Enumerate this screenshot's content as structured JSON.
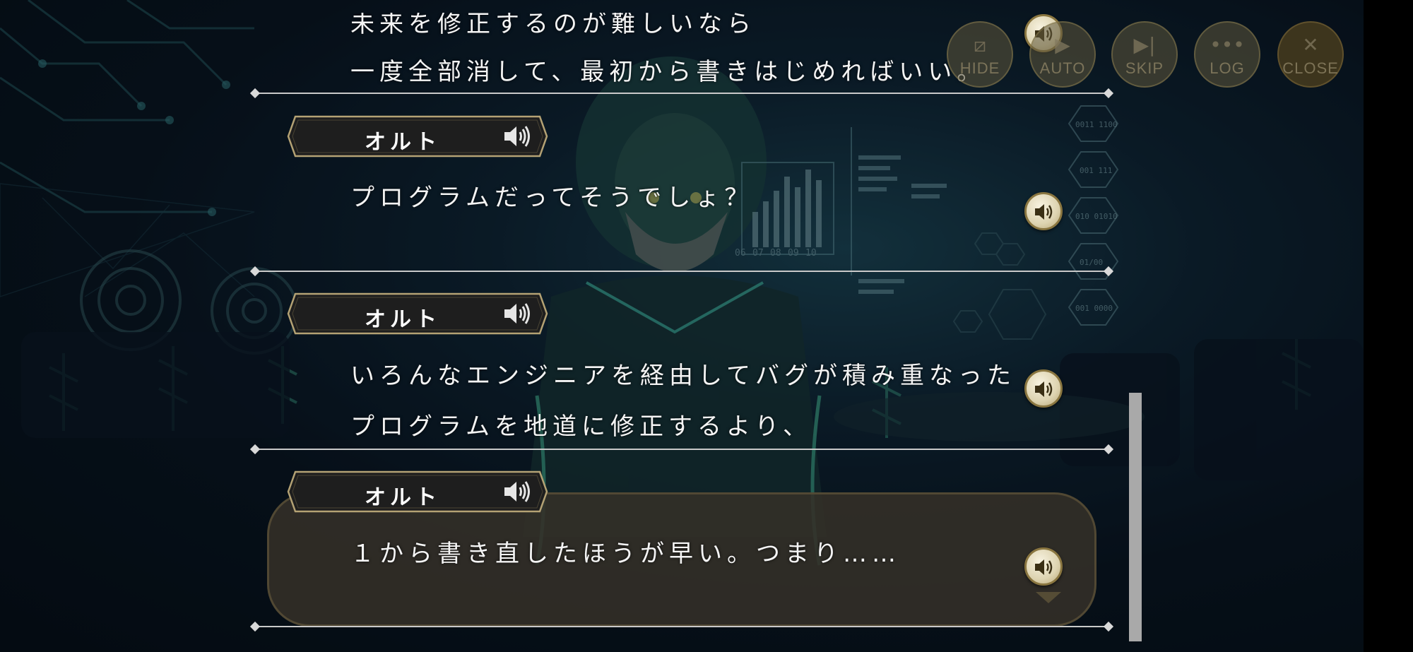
{
  "controls": [
    {
      "label": "HIDE",
      "glyph": "⧄"
    },
    {
      "label": "AUTO",
      "glyph": "▶"
    },
    {
      "label": "SKIP",
      "glyph": "▶|"
    },
    {
      "label": "LOG",
      "glyph": "•••"
    },
    {
      "label": "CLOSE",
      "glyph": "✕"
    }
  ],
  "log": {
    "entries": [
      {
        "speaker": "",
        "lines": [
          "未来を修正するのが難しいなら",
          "一度全部消して、最初から書きはじめればいい。"
        ]
      },
      {
        "speaker": "オルト",
        "lines": [
          "プログラムだってそうでしょ？"
        ]
      },
      {
        "speaker": "オルト",
        "lines": [
          "いろんなエンジニアを経由してバグが積み重なった",
          "プログラムを地道に修正するより、"
        ]
      },
      {
        "speaker": "オルト",
        "lines": [
          "１から書き直したほうが早い。つまり……"
        ]
      }
    ]
  },
  "background": {
    "chart_ticks": [
      "06",
      "07",
      "08",
      "09",
      "10"
    ],
    "hex_labels": [
      "0011 1100",
      "001 111",
      "010 01010",
      "01/00",
      "001 0000"
    ]
  },
  "colors": {
    "accent_gold": "#8a7640",
    "text": "#f4f4f4",
    "separator": "#c9c9c9"
  }
}
